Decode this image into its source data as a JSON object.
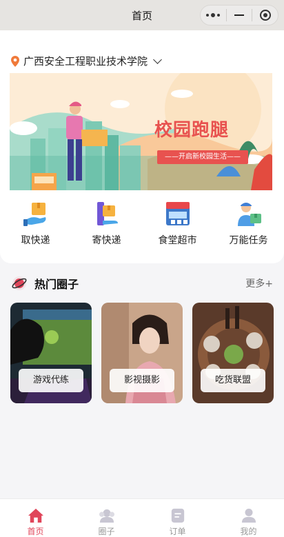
{
  "navbar": {
    "title": "首页"
  },
  "location": {
    "school": "广西安全工程职业技术学院"
  },
  "banner": {
    "title": "校园跑腿",
    "subtitle": "——开启新校园生活——"
  },
  "quick_actions": [
    {
      "label": "取快递",
      "icon": "package-hand-icon"
    },
    {
      "label": "寄快递",
      "icon": "send-package-icon"
    },
    {
      "label": "食堂超市",
      "icon": "store-icon"
    },
    {
      "label": "万能任务",
      "icon": "courier-icon"
    }
  ],
  "hot": {
    "title": "热门圈子",
    "more": "更多+"
  },
  "circles": [
    {
      "label": "游戏代练"
    },
    {
      "label": "影视摄影"
    },
    {
      "label": "吃货联盟"
    }
  ],
  "tabs": [
    {
      "label": "首页",
      "active": true
    },
    {
      "label": "圈子",
      "active": false
    },
    {
      "label": "订单",
      "active": false
    },
    {
      "label": "我的",
      "active": false
    }
  ],
  "colors": {
    "accent": "#e0455a",
    "banner_red": "#e8524f",
    "inactive": "#c8c6d2"
  }
}
